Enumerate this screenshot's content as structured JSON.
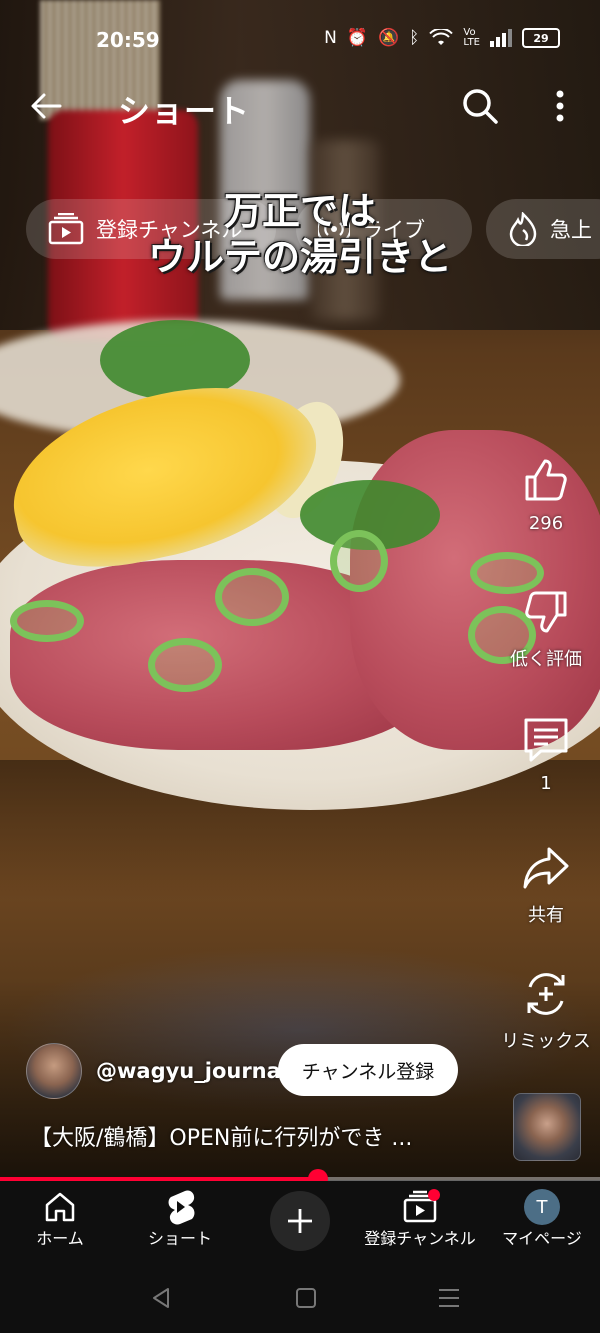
{
  "status_bar": {
    "time": "20:59",
    "battery": "29"
  },
  "header": {
    "title": "ショート"
  },
  "chips": [
    {
      "label": "登録チャンネル",
      "icon": "subscriptions-icon"
    },
    {
      "label": "ライブ",
      "icon": "live-icon"
    },
    {
      "label": "急上",
      "icon": "trending-icon"
    }
  ],
  "caption": {
    "line1": "万正では",
    "line2": "ウルテの湯引きと"
  },
  "actions": {
    "like_count": "296",
    "dislike_label": "低く評価",
    "comment_count": "1",
    "share_label": "共有",
    "remix_label": "リミックス"
  },
  "video": {
    "channel_handle": "@wagyu_journal",
    "subscribe_label": "チャンネル登録",
    "title": "【大阪/鶴橋】OPEN前に行列ができ ...",
    "progress": 0.53
  },
  "bottom_nav": {
    "home": "ホーム",
    "shorts": "ショート",
    "subscriptions": "登録チャンネル",
    "you": "マイページ",
    "profile_initial": "T"
  },
  "colors": {
    "accent": "#ff0033",
    "nav_bg": "#0f0f0f"
  }
}
